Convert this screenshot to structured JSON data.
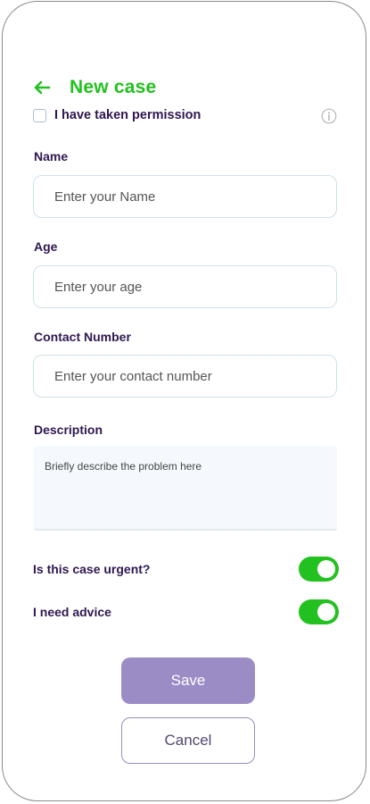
{
  "header": {
    "title": "New case",
    "back_icon": "arrow-left-icon"
  },
  "permission": {
    "label": "I have taken permission",
    "checked": false,
    "info_icon": "info-icon"
  },
  "form": {
    "name": {
      "label": "Name",
      "placeholder": "Enter your Name"
    },
    "age": {
      "label": "Age",
      "placeholder": "Enter your age"
    },
    "contact": {
      "label": "Contact Number",
      "placeholder": "Enter your contact number"
    },
    "description": {
      "label": "Description",
      "placeholder": "Briefly describe the problem here"
    }
  },
  "toggles": {
    "urgent": {
      "label": "Is this case urgent?",
      "on": true
    },
    "advice": {
      "label": "I need advice",
      "on": true
    }
  },
  "actions": {
    "save_label": "Save",
    "cancel_label": "Cancel"
  },
  "colors": {
    "accent_green": "#22c11f",
    "text_purple": "#2f1850",
    "save_purple": "#9b8cc6"
  }
}
